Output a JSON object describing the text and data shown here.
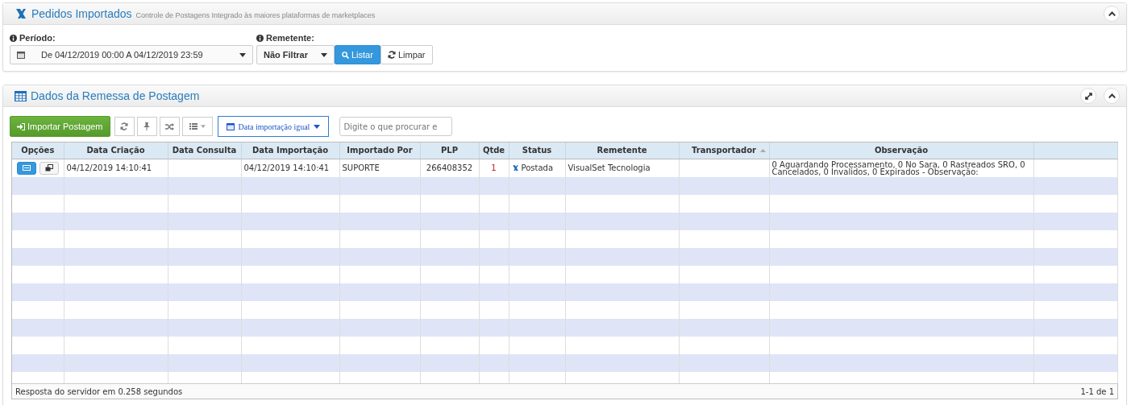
{
  "import_panel": {
    "title": "Pedidos Importados",
    "subtitle": "Controle de Postagens Integrado às maiores plataformas de marketplaces",
    "period": {
      "label": "Período:",
      "value": "De 04/12/2019 00:00 A 04/12/2019 23:59"
    },
    "sender": {
      "label": "Remetente:",
      "value": "Não Filtrar"
    },
    "buttons": [
      "Listar",
      "Limpar"
    ]
  },
  "data_panel": {
    "title": "Dados da Remessa de Postagem",
    "import_button": "Importar Postagem",
    "filter_button": "Data importação igual",
    "search": {
      "placeholder": "Digite o que procurar e"
    },
    "table": {
      "columns": [
        {
          "label": "Opções",
          "sorted": false
        },
        {
          "label": "Data Criação",
          "sorted": false
        },
        {
          "label": "Data Consulta",
          "sorted": false
        },
        {
          "label": "Data Importação",
          "sorted": false
        },
        {
          "label": "Importado Por",
          "sorted": false
        },
        {
          "label": "PLP",
          "sorted": false
        },
        {
          "label": "Qtde",
          "sorted": false
        },
        {
          "label": "Status",
          "sorted": false
        },
        {
          "label": "Remetente",
          "sorted": false
        },
        {
          "label": "Transportador",
          "sorted": true
        },
        {
          "label": "Observação",
          "sorted": false
        }
      ],
      "rows": [
        {
          "data_criacao": "04/12/2019 14:10:41",
          "data_consulta": "",
          "data_importacao": "04/12/2019 14:10:41",
          "importado_por": "SUPORTE",
          "plp": "266408352",
          "qtde": "1",
          "status": "Postada",
          "remetente": "VisualSet Tecnologia",
          "transportador": "",
          "observacao": "0 Aguardando Processamento, 0 No Sara, 0 Rastreados SRO, 0 Cancelados, 0 Invalidos, 0 Expirados - Observação:"
        }
      ]
    },
    "footer": {
      "message": "Resposta do servidor em 0.258 segundos",
      "pagination": "1-1 de 1"
    }
  }
}
